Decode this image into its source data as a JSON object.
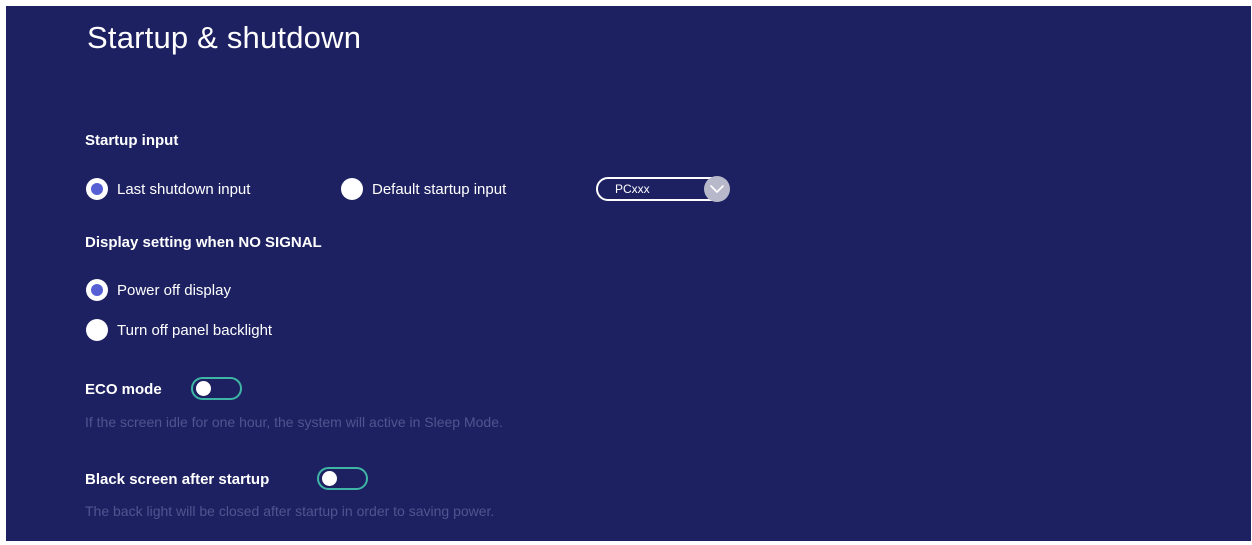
{
  "page": {
    "title": "Startup & shutdown"
  },
  "startup_input": {
    "label": "Startup input",
    "options": [
      {
        "label": "Last shutdown input",
        "checked": true
      },
      {
        "label": "Default startup input",
        "checked": false
      }
    ],
    "source_select": {
      "value": "PCxxx",
      "icon": "chevron-down-icon"
    }
  },
  "no_signal": {
    "label": "Display setting when NO SIGNAL",
    "options": [
      {
        "label": "Power off display",
        "checked": true
      },
      {
        "label": "Turn off panel backlight",
        "checked": false
      }
    ]
  },
  "eco_mode": {
    "label": "ECO mode",
    "enabled": false,
    "description": "If the screen idle for one hour, the system will active in Sleep Mode."
  },
  "black_screen": {
    "label": "Black screen after startup",
    "enabled": false,
    "description": "The back light will be closed after startup in order to saving power."
  },
  "colors": {
    "background": "#1d2161",
    "radio_selected": "#5660d4",
    "toggle_border": "#3fb5a5",
    "description_text": "#4f5590"
  }
}
